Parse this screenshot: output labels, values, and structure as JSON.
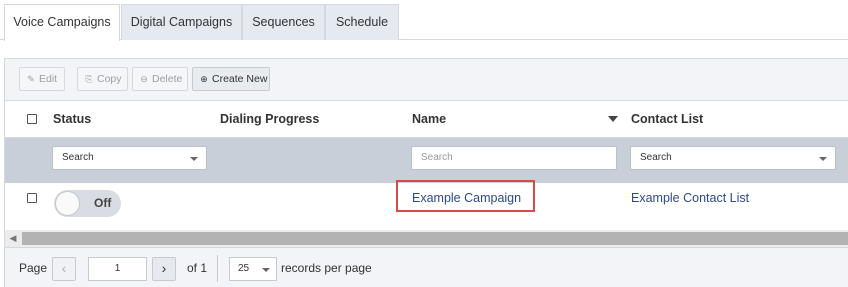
{
  "tabs": [
    {
      "label": "Voice Campaigns",
      "active": true
    },
    {
      "label": "Digital Campaigns",
      "active": false
    },
    {
      "label": "Sequences",
      "active": false
    },
    {
      "label": "Schedule",
      "active": false
    }
  ],
  "toolbar": {
    "edit_label": "Edit",
    "copy_label": "Copy",
    "delete_label": "Delete",
    "create_label": "Create New"
  },
  "table": {
    "columns": [
      "Status",
      "Dialing Progress",
      "Name",
      "Contact List"
    ],
    "filters": {
      "status": "Search",
      "name_placeholder": "Search",
      "contact_list": "Search"
    },
    "rows": [
      {
        "status": "Off",
        "name": "Example Campaign",
        "contact_list": "Example Contact List"
      }
    ]
  },
  "pager": {
    "page_label": "Page",
    "current_page": "1",
    "of_label": "of 1",
    "page_size": "25",
    "records_label": "records per page"
  },
  "colors": {
    "link": "#2b4a8c",
    "highlight_border": "#d9484a",
    "filter_bar": "#c8cfd9"
  }
}
